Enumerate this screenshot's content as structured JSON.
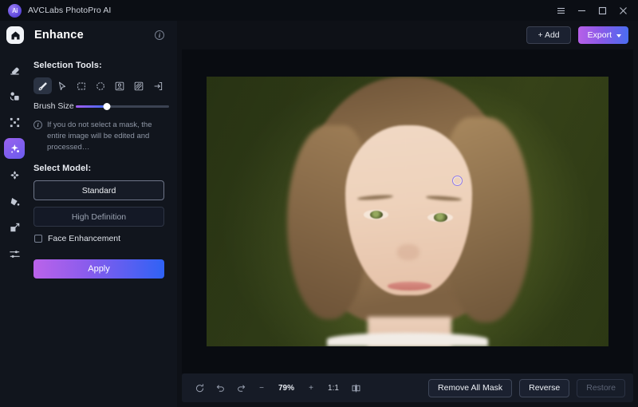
{
  "titlebar": {
    "app_name": "AVCLabs PhotoPro AI",
    "logo_text": "Ai",
    "controls": [
      {
        "name": "menu-icon",
        "label": "☰"
      },
      {
        "name": "minimize-icon",
        "label": "−"
      },
      {
        "name": "maximize-icon",
        "label": "□"
      },
      {
        "name": "close-icon",
        "label": "✕"
      }
    ]
  },
  "header": {
    "home_icon": "home-icon",
    "title": "Enhance",
    "info_icon_label": "i",
    "add_label": "+ Add",
    "export_label": "Export"
  },
  "rail": {
    "items": [
      {
        "icon": "eraser-icon",
        "active": false
      },
      {
        "icon": "object-removal-icon",
        "active": false
      },
      {
        "icon": "upscale-icon",
        "active": false
      },
      {
        "icon": "enhance-icon",
        "active": true
      },
      {
        "icon": "retouch-icon",
        "active": false
      },
      {
        "icon": "colorize-icon",
        "active": false
      },
      {
        "icon": "resize-icon",
        "active": false
      },
      {
        "icon": "adjust-icon",
        "active": false
      }
    ]
  },
  "panel": {
    "selection_tools_label": "Selection Tools:",
    "tools": [
      {
        "name": "brush-tool",
        "active": true
      },
      {
        "name": "pointer-tool",
        "active": false
      },
      {
        "name": "rectangle-select-tool",
        "active": false
      },
      {
        "name": "ellipse-select-tool",
        "active": false
      },
      {
        "name": "portrait-select-tool",
        "active": false
      },
      {
        "name": "background-select-tool",
        "active": false
      },
      {
        "name": "import-mask-tool",
        "active": false
      }
    ],
    "brush_size_label": "Brush Size",
    "brush_size_value": 33,
    "hint_icon_label": "i",
    "hint_text": "If you do not select a mask, the entire image will be edited and processed…",
    "select_model_label": "Select Model:",
    "models": [
      {
        "label": "Standard",
        "selected": true
      },
      {
        "label": "High Definition",
        "selected": false
      }
    ],
    "face_enhancement_label": "Face Enhancement",
    "face_enhancement_checked": false,
    "apply_label": "Apply"
  },
  "bottombar": {
    "reset_icon": "reset-icon",
    "undo_icon": "undo-icon",
    "redo_icon": "redo-icon",
    "zoom_out_label": "−",
    "zoom_level": "79%",
    "zoom_in_label": "+",
    "actual_size_label": "1:1",
    "compare_icon": "split-compare-icon",
    "remove_all_mask_label": "Remove All Mask",
    "reverse_label": "Reverse",
    "restore_label": "Restore",
    "restore_disabled": true
  },
  "colors": {
    "accent_purple": "#8a5ae8",
    "accent_blue": "#4a6df0",
    "panel_bg": "#11151d",
    "canvas_bg": "#090c11",
    "window_bg": "#0e1117"
  }
}
